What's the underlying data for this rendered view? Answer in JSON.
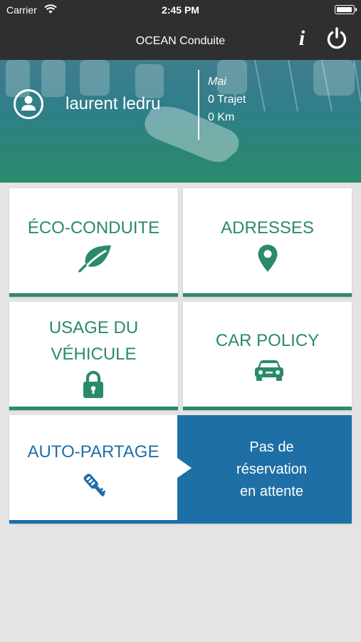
{
  "status_bar": {
    "carrier": "Carrier",
    "time": "2:45 PM",
    "wifi_icon": "wifi-icon",
    "battery_icon": "battery-icon"
  },
  "nav": {
    "title": "OCEAN Conduite",
    "info_label": "i",
    "info_icon": "info-icon",
    "power_icon": "power-icon"
  },
  "banner": {
    "user_icon": "user-avatar-icon",
    "user_name": "laurent ledru",
    "month": "Mai",
    "trips": "0 Trajet",
    "distance": "0 Km"
  },
  "tiles": [
    {
      "label": "ÉCO-CONDUITE",
      "icon": "leaf-icon"
    },
    {
      "label": "ADRESSES",
      "icon": "map-pin-icon"
    },
    {
      "label_line1": "USAGE DU",
      "label_line2": "VÉHICULE",
      "icon": "lock-icon"
    },
    {
      "label": "CAR POLICY",
      "icon": "car-icon"
    }
  ],
  "auto_partage": {
    "label": "AUTO-PARTAGE",
    "icon": "car-key-icon",
    "message_line1": "Pas de",
    "message_line2": "réservation",
    "message_line3": "en attente"
  },
  "colors": {
    "green": "#2a8a6c",
    "blue": "#1e6fa5",
    "dark_bar": "#2f2f2f",
    "background": "#e4e4e4"
  }
}
